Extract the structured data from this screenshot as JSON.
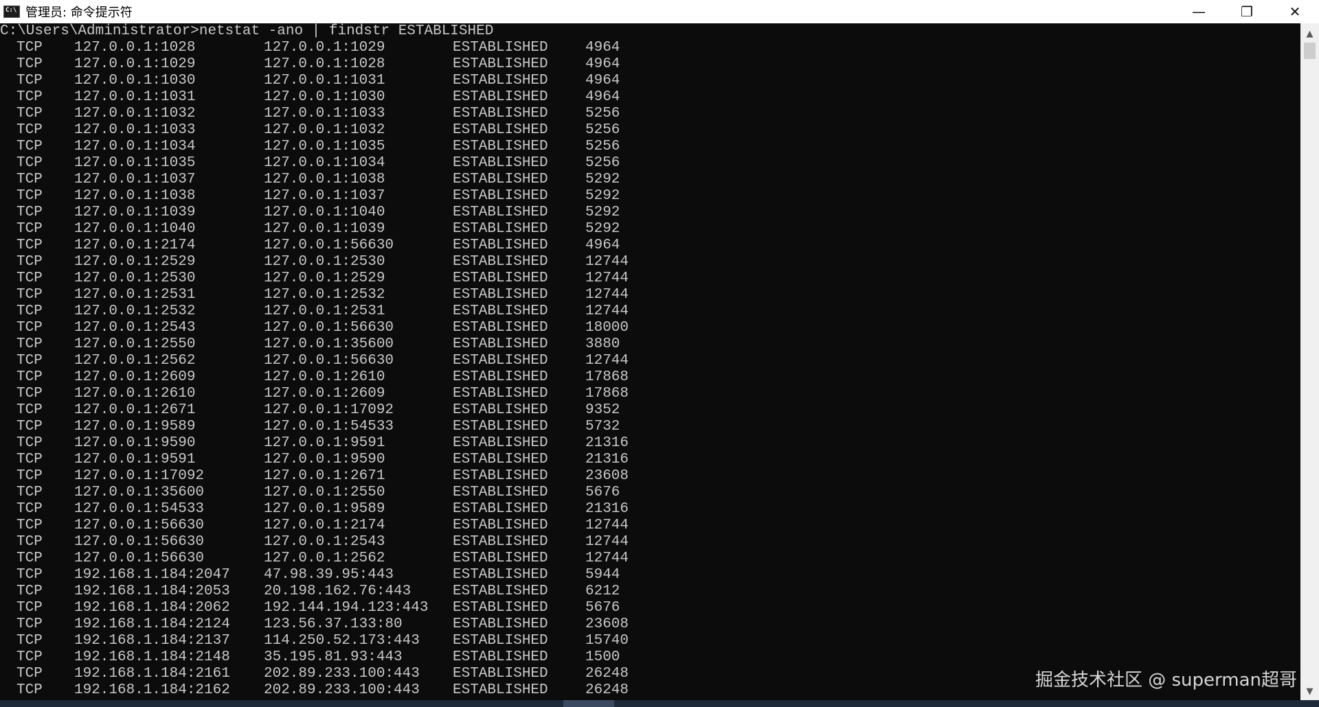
{
  "window": {
    "title": "管理员: 命令提示符"
  },
  "controls": {
    "minimize": "—",
    "restore": "❐",
    "close": "✕"
  },
  "console": {
    "prompt": "C:\\Users\\Administrator>netstat -ano | findstr ESTABLISHED",
    "rows": [
      {
        "proto": "TCP",
        "local": "127.0.0.1:1028",
        "foreign": "127.0.0.1:1029",
        "state": "ESTABLISHED",
        "pid": "4964"
      },
      {
        "proto": "TCP",
        "local": "127.0.0.1:1029",
        "foreign": "127.0.0.1:1028",
        "state": "ESTABLISHED",
        "pid": "4964"
      },
      {
        "proto": "TCP",
        "local": "127.0.0.1:1030",
        "foreign": "127.0.0.1:1031",
        "state": "ESTABLISHED",
        "pid": "4964"
      },
      {
        "proto": "TCP",
        "local": "127.0.0.1:1031",
        "foreign": "127.0.0.1:1030",
        "state": "ESTABLISHED",
        "pid": "4964"
      },
      {
        "proto": "TCP",
        "local": "127.0.0.1:1032",
        "foreign": "127.0.0.1:1033",
        "state": "ESTABLISHED",
        "pid": "5256"
      },
      {
        "proto": "TCP",
        "local": "127.0.0.1:1033",
        "foreign": "127.0.0.1:1032",
        "state": "ESTABLISHED",
        "pid": "5256"
      },
      {
        "proto": "TCP",
        "local": "127.0.0.1:1034",
        "foreign": "127.0.0.1:1035",
        "state": "ESTABLISHED",
        "pid": "5256"
      },
      {
        "proto": "TCP",
        "local": "127.0.0.1:1035",
        "foreign": "127.0.0.1:1034",
        "state": "ESTABLISHED",
        "pid": "5256"
      },
      {
        "proto": "TCP",
        "local": "127.0.0.1:1037",
        "foreign": "127.0.0.1:1038",
        "state": "ESTABLISHED",
        "pid": "5292"
      },
      {
        "proto": "TCP",
        "local": "127.0.0.1:1038",
        "foreign": "127.0.0.1:1037",
        "state": "ESTABLISHED",
        "pid": "5292"
      },
      {
        "proto": "TCP",
        "local": "127.0.0.1:1039",
        "foreign": "127.0.0.1:1040",
        "state": "ESTABLISHED",
        "pid": "5292"
      },
      {
        "proto": "TCP",
        "local": "127.0.0.1:1040",
        "foreign": "127.0.0.1:1039",
        "state": "ESTABLISHED",
        "pid": "5292"
      },
      {
        "proto": "TCP",
        "local": "127.0.0.1:2174",
        "foreign": "127.0.0.1:56630",
        "state": "ESTABLISHED",
        "pid": "4964"
      },
      {
        "proto": "TCP",
        "local": "127.0.0.1:2529",
        "foreign": "127.0.0.1:2530",
        "state": "ESTABLISHED",
        "pid": "12744"
      },
      {
        "proto": "TCP",
        "local": "127.0.0.1:2530",
        "foreign": "127.0.0.1:2529",
        "state": "ESTABLISHED",
        "pid": "12744"
      },
      {
        "proto": "TCP",
        "local": "127.0.0.1:2531",
        "foreign": "127.0.0.1:2532",
        "state": "ESTABLISHED",
        "pid": "12744"
      },
      {
        "proto": "TCP",
        "local": "127.0.0.1:2532",
        "foreign": "127.0.0.1:2531",
        "state": "ESTABLISHED",
        "pid": "12744"
      },
      {
        "proto": "TCP",
        "local": "127.0.0.1:2543",
        "foreign": "127.0.0.1:56630",
        "state": "ESTABLISHED",
        "pid": "18000"
      },
      {
        "proto": "TCP",
        "local": "127.0.0.1:2550",
        "foreign": "127.0.0.1:35600",
        "state": "ESTABLISHED",
        "pid": "3880"
      },
      {
        "proto": "TCP",
        "local": "127.0.0.1:2562",
        "foreign": "127.0.0.1:56630",
        "state": "ESTABLISHED",
        "pid": "12744"
      },
      {
        "proto": "TCP",
        "local": "127.0.0.1:2609",
        "foreign": "127.0.0.1:2610",
        "state": "ESTABLISHED",
        "pid": "17868"
      },
      {
        "proto": "TCP",
        "local": "127.0.0.1:2610",
        "foreign": "127.0.0.1:2609",
        "state": "ESTABLISHED",
        "pid": "17868"
      },
      {
        "proto": "TCP",
        "local": "127.0.0.1:2671",
        "foreign": "127.0.0.1:17092",
        "state": "ESTABLISHED",
        "pid": "9352"
      },
      {
        "proto": "TCP",
        "local": "127.0.0.1:9589",
        "foreign": "127.0.0.1:54533",
        "state": "ESTABLISHED",
        "pid": "5732"
      },
      {
        "proto": "TCP",
        "local": "127.0.0.1:9590",
        "foreign": "127.0.0.1:9591",
        "state": "ESTABLISHED",
        "pid": "21316"
      },
      {
        "proto": "TCP",
        "local": "127.0.0.1:9591",
        "foreign": "127.0.0.1:9590",
        "state": "ESTABLISHED",
        "pid": "21316"
      },
      {
        "proto": "TCP",
        "local": "127.0.0.1:17092",
        "foreign": "127.0.0.1:2671",
        "state": "ESTABLISHED",
        "pid": "23608"
      },
      {
        "proto": "TCP",
        "local": "127.0.0.1:35600",
        "foreign": "127.0.0.1:2550",
        "state": "ESTABLISHED",
        "pid": "5676"
      },
      {
        "proto": "TCP",
        "local": "127.0.0.1:54533",
        "foreign": "127.0.0.1:9589",
        "state": "ESTABLISHED",
        "pid": "21316"
      },
      {
        "proto": "TCP",
        "local": "127.0.0.1:56630",
        "foreign": "127.0.0.1:2174",
        "state": "ESTABLISHED",
        "pid": "12744"
      },
      {
        "proto": "TCP",
        "local": "127.0.0.1:56630",
        "foreign": "127.0.0.1:2543",
        "state": "ESTABLISHED",
        "pid": "12744"
      },
      {
        "proto": "TCP",
        "local": "127.0.0.1:56630",
        "foreign": "127.0.0.1:2562",
        "state": "ESTABLISHED",
        "pid": "12744"
      },
      {
        "proto": "TCP",
        "local": "192.168.1.184:2047",
        "foreign": "47.98.39.95:443",
        "state": "ESTABLISHED",
        "pid": "5944"
      },
      {
        "proto": "TCP",
        "local": "192.168.1.184:2053",
        "foreign": "20.198.162.76:443",
        "state": "ESTABLISHED",
        "pid": "6212"
      },
      {
        "proto": "TCP",
        "local": "192.168.1.184:2062",
        "foreign": "192.144.194.123:443",
        "state": "ESTABLISHED",
        "pid": "5676"
      },
      {
        "proto": "TCP",
        "local": "192.168.1.184:2124",
        "foreign": "123.56.37.133:80",
        "state": "ESTABLISHED",
        "pid": "23608"
      },
      {
        "proto": "TCP",
        "local": "192.168.1.184:2137",
        "foreign": "114.250.52.173:443",
        "state": "ESTABLISHED",
        "pid": "15740"
      },
      {
        "proto": "TCP",
        "local": "192.168.1.184:2148",
        "foreign": "35.195.81.93:443",
        "state": "ESTABLISHED",
        "pid": "1500"
      },
      {
        "proto": "TCP",
        "local": "192.168.1.184:2161",
        "foreign": "202.89.233.100:443",
        "state": "ESTABLISHED",
        "pid": "26248"
      },
      {
        "proto": "TCP",
        "local": "192.168.1.184:2162",
        "foreign": "202.89.233.100:443",
        "state": "ESTABLISHED",
        "pid": "26248"
      }
    ]
  },
  "watermark": "掘金技术社区 @ superman超哥",
  "scrollbar": {
    "up": "▲",
    "down": "▼"
  }
}
